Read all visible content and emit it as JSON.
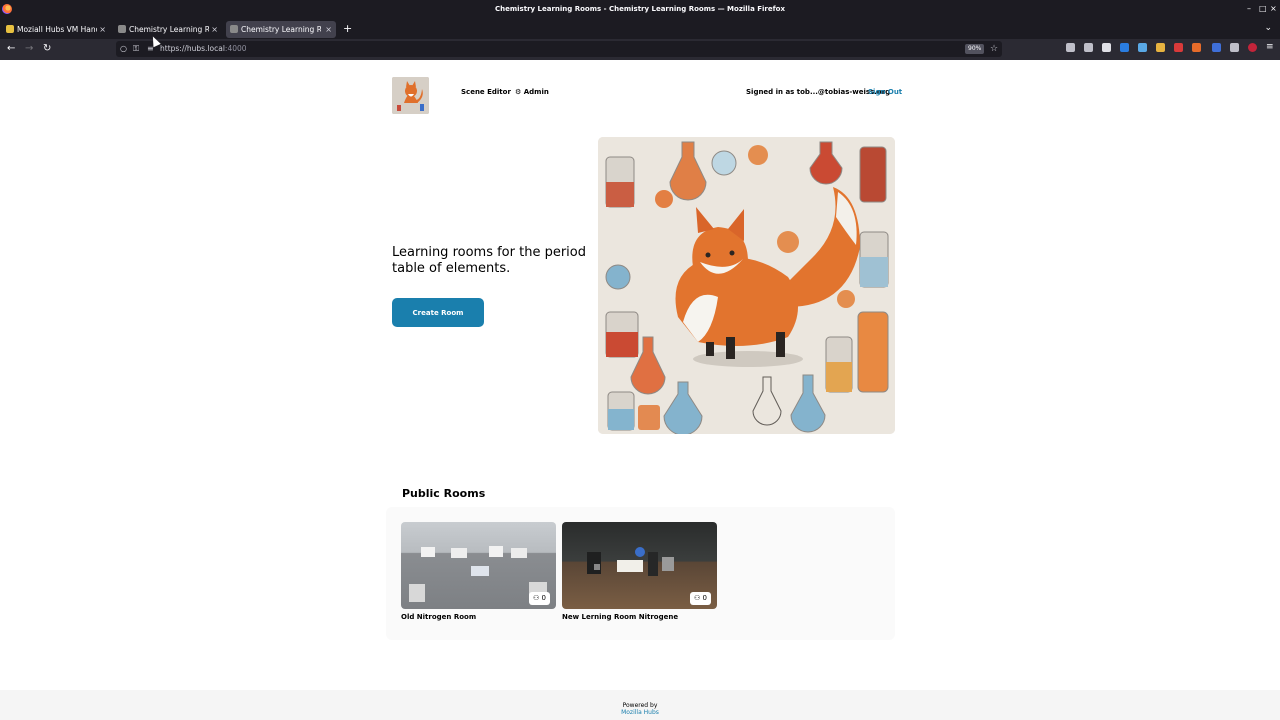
{
  "window": {
    "title": "Chemistry Learning Rooms - Chemistry Learning Rooms — Mozilla Firefox"
  },
  "tabs": [
    {
      "label": "Moziall Hubs VM Hand O",
      "active": false
    },
    {
      "label": "Chemistry Learning Roo",
      "active": false
    },
    {
      "label": "Chemistry Learning Roo",
      "active": true
    }
  ],
  "url": {
    "host": "https://hubs.local",
    "port": ":4000",
    "zoom": "90%"
  },
  "header": {
    "scene_editor": "Scene Editor",
    "admin": "Admin",
    "signed_in": "Signed in as tob...@tobias-weiss.org",
    "sign_out": "Sign Out"
  },
  "hero": {
    "text": "Learning rooms for the period table of elements.",
    "create_button": "Create Room"
  },
  "public_rooms": {
    "title": "Public Rooms",
    "rooms": [
      {
        "name": "Old Nitrogen Room",
        "members": "0"
      },
      {
        "name": "New Lerning Room Nitrogene",
        "members": "0"
      }
    ]
  },
  "footer": {
    "powered_by": "Powered by",
    "hubs": "Mozilla Hubs"
  },
  "colors": {
    "accent": "#1a7fad",
    "chrome_dark": "#1c1b22",
    "toolbar": "#2b2a33"
  }
}
